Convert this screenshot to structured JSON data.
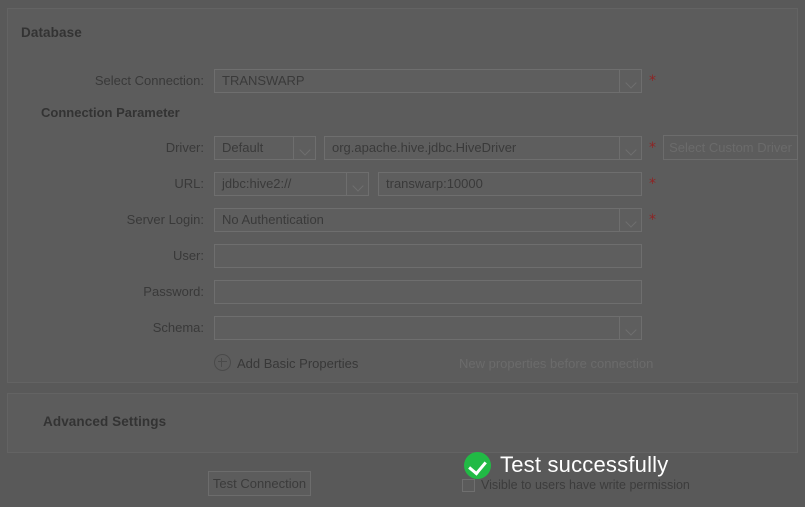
{
  "database_panel": {
    "title": "Database",
    "select_connection": {
      "label": "Select Connection:",
      "value": "TRANSWARP",
      "required_mark": "*"
    },
    "connection_parameter_heading": "Connection Parameter",
    "driver": {
      "label": "Driver:",
      "type_value": "Default",
      "class_value": "org.apache.hive.jdbc.HiveDriver",
      "required_mark": "*",
      "custom_driver_button": "Select Custom Driver"
    },
    "url": {
      "label": "URL:",
      "scheme_value": "jdbc:hive2://",
      "host_value": "transwarp:10000",
      "required_mark": "*"
    },
    "server_login": {
      "label": "Server Login:",
      "value": "No Authentication",
      "required_mark": "*"
    },
    "user": {
      "label": "User:",
      "value": ""
    },
    "password": {
      "label": "Password:",
      "value": ""
    },
    "schema": {
      "label": "Schema:",
      "value": ""
    },
    "add_basic_properties": "Add Basic Properties",
    "properties_hint": "New properties before connection"
  },
  "advanced_panel": {
    "title": "Advanced Settings"
  },
  "footer": {
    "test_connection_button": "Test Connection",
    "visible_checkbox_label": "Visible to users have write permission",
    "visible_checkbox_checked": false
  },
  "toast": {
    "message": "Test successfully",
    "icon": "check-circle-icon",
    "accent_color": "#21ba45",
    "text_color": "#ffffff"
  },
  "theme": {
    "page_background": "#595959",
    "panel_background": "#5c5c5c",
    "required_color": "#8e2525"
  }
}
